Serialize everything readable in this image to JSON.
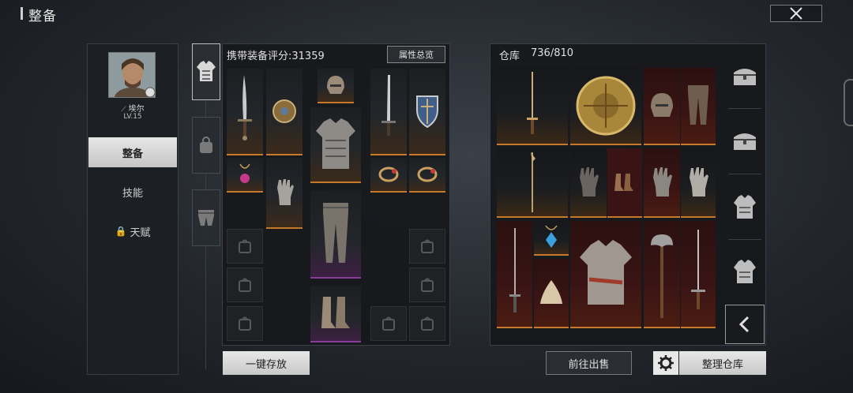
{
  "header": {
    "title": "整备"
  },
  "character": {
    "name": "埃尔",
    "level": "LV.15"
  },
  "side_tabs": [
    {
      "label": "整备",
      "active": true
    },
    {
      "label": "技能",
      "active": false
    },
    {
      "label": "天赋",
      "active": false,
      "locked": true
    }
  ],
  "category_tabs": [
    {
      "icon": "armor-icon",
      "active": true
    },
    {
      "icon": "accessory-icon",
      "active": false
    },
    {
      "icon": "legs-icon",
      "active": false
    }
  ],
  "equipment": {
    "score_label": "携带装备评分:31359",
    "attr_button": "属性总览",
    "slots": [
      {
        "icon": "sword-icon",
        "rarity": "orange"
      },
      {
        "icon": "round-shield-icon",
        "rarity": "orange"
      },
      {
        "icon": "helmet-icon",
        "rarity": "orange"
      },
      {
        "icon": "chest-armor-icon",
        "rarity": "orange"
      },
      {
        "icon": "sword-icon",
        "rarity": "orange"
      },
      {
        "icon": "kite-shield-icon",
        "rarity": "orange"
      },
      {
        "icon": "amulet-icon",
        "rarity": "orange"
      },
      {
        "icon": "gauntlet-icon",
        "rarity": "orange"
      },
      {
        "icon": "ring-icon",
        "rarity": "orange"
      },
      {
        "icon": "ring-icon",
        "rarity": "orange"
      },
      {
        "icon": "pants-icon",
        "rarity": "purple"
      },
      {
        "icon": "boots-icon",
        "rarity": "purple"
      }
    ]
  },
  "warehouse": {
    "title": "仓库",
    "count": "736/810",
    "items": [
      {
        "icon": "longsword-icon",
        "rarity": "orange"
      },
      {
        "icon": "round-shield-icon",
        "rarity": "orange"
      },
      {
        "icon": "helmet-icon",
        "rarity": "red"
      },
      {
        "icon": "pants-icon",
        "rarity": "red"
      },
      {
        "icon": "polearm-icon",
        "rarity": "orange"
      },
      {
        "icon": "gauntlet-icon",
        "rarity": "orange"
      },
      {
        "icon": "boots-icon",
        "rarity": "red"
      },
      {
        "icon": "gauntlet-icon",
        "rarity": "red"
      },
      {
        "icon": "gauntlet-icon",
        "rarity": "orange"
      },
      {
        "icon": "longsword-icon",
        "rarity": "red"
      },
      {
        "icon": "amulet-icon",
        "rarity": "orange"
      },
      {
        "icon": "hood-icon",
        "rarity": "red"
      },
      {
        "icon": "chest-armor-icon",
        "rarity": "red"
      },
      {
        "icon": "axe-icon",
        "rarity": "red"
      },
      {
        "icon": "longsword-icon",
        "rarity": "red"
      }
    ]
  },
  "filters": [
    "chest-filter-icon",
    "chest-filter-icon",
    "armor-filter-icon",
    "armor-filter-icon"
  ],
  "buttons": {
    "store": "一键存放",
    "sell": "前往出售",
    "arrange": "整理仓库"
  },
  "colors": {
    "orange": "#c6782b",
    "purple": "#8a3c9a",
    "red": "#3a1414",
    "button_light": "#e0e0e0"
  }
}
